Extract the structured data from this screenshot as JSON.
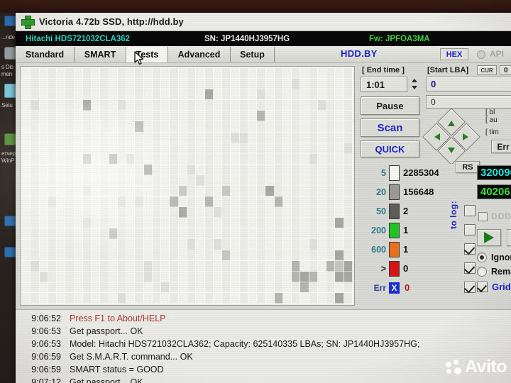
{
  "window": {
    "title": "Victoria 4.72b SSD, http://hdd.by",
    "icon": "green-plus-icon"
  },
  "drive_bar": {
    "model": "Hitachi HDS721032CLA362",
    "serial": "SN: JP1440HJ3957HG",
    "firmware": "Fw: JPFOA3MA",
    "model_color": "#27d6c0",
    "fw_color": "#3fd23f"
  },
  "tabs": [
    {
      "label": "Standard",
      "active": false
    },
    {
      "label": "SMART",
      "active": false
    },
    {
      "label": "Tests",
      "active": true
    },
    {
      "label": "Advanced",
      "active": false
    },
    {
      "label": "Setup",
      "active": false
    }
  ],
  "tabbar_extras": {
    "brand": "HDD.BY",
    "brand_color": "#1b25c8",
    "hex_button": "HEX",
    "api_label": "API"
  },
  "controls": {
    "end_time_label": "[ End time ]",
    "end_time_value": "1:01",
    "start_lba_label": "[Start LBA]",
    "cur_button": "CUR",
    "cur_value": "0",
    "lba_field_1": "0",
    "lba_field_2": "0",
    "pause_button": "Pause",
    "scan_button": "Scan",
    "quick_button": "QUICK",
    "err_button": "Err",
    "bracket_lines": [
      "[ bl",
      "[ au",
      "[ tim"
    ],
    "nav_pad": [
      "up",
      "down",
      "left",
      "right"
    ]
  },
  "stats": {
    "rs_button": "RS",
    "to_log_label": "to log:",
    "rows": [
      {
        "threshold": "5",
        "color": "#f6f6f2",
        "value": "2285304",
        "checked": false,
        "show_check": false
      },
      {
        "threshold": "20",
        "color": "#9a9a96",
        "value": "156648",
        "checked": false,
        "show_check": false
      },
      {
        "threshold": "50",
        "color": "#5d5d5a",
        "value": "2",
        "checked": false,
        "show_check": true
      },
      {
        "threshold": "200",
        "color": "#22c422",
        "value": "1",
        "checked": false,
        "show_check": true
      },
      {
        "threshold": "600",
        "color": "#e8731b",
        "value": "1",
        "checked": true,
        "show_check": true
      },
      {
        "threshold": ">",
        "color": "#d81414",
        "value": "0",
        "checked": true,
        "show_check": true
      },
      {
        "threshold": "Err",
        "color": "#1a2fd8",
        "value": "0",
        "checked": true,
        "show_check": true
      }
    ]
  },
  "led_panel": {
    "led_top_value": "320090",
    "led_top_color": "#2fe0d8",
    "led_bottom_value": "40206",
    "led_bottom_color": "#3ce03c",
    "ddd_label": "DDD"
  },
  "actions": {
    "play_button": "play-icon",
    "next_button": "prev-icon",
    "ignore_label": "Ignore",
    "remap_label": "Remap",
    "ignore_selected": true,
    "grid_label": "Grid",
    "grid_checked": true
  },
  "block_map": {
    "columns": 38,
    "rows": 22,
    "base_color": "#eeeeea",
    "legend": "scan block map"
  },
  "log": {
    "entries": [
      {
        "time": "9:06:52",
        "message": "Press F1 to About/HELP",
        "warn": true
      },
      {
        "time": "9:06:53",
        "message": "Get passport... OK",
        "warn": false
      },
      {
        "time": "9:06:53",
        "message": "Model: Hitachi HDS721032CLA362; Capacity: 625140335 LBAs; SN: JP1440HJ3957HG;",
        "warn": false
      },
      {
        "time": "9:06:59",
        "message": "Get S.M.A.R.T. command... OK",
        "warn": false
      },
      {
        "time": "9:06:59",
        "message": "SMART status = GOOD",
        "warn": false
      },
      {
        "time": "9:07:12",
        "message": "Get passport... OK",
        "warn": false
      }
    ]
  },
  "desktop": {
    "icon_labels": [
      "...nde",
      "s Dis",
      "men",
      "Setu",
      "етчер",
      "WinP"
    ]
  },
  "watermark": {
    "text": "Avito"
  }
}
